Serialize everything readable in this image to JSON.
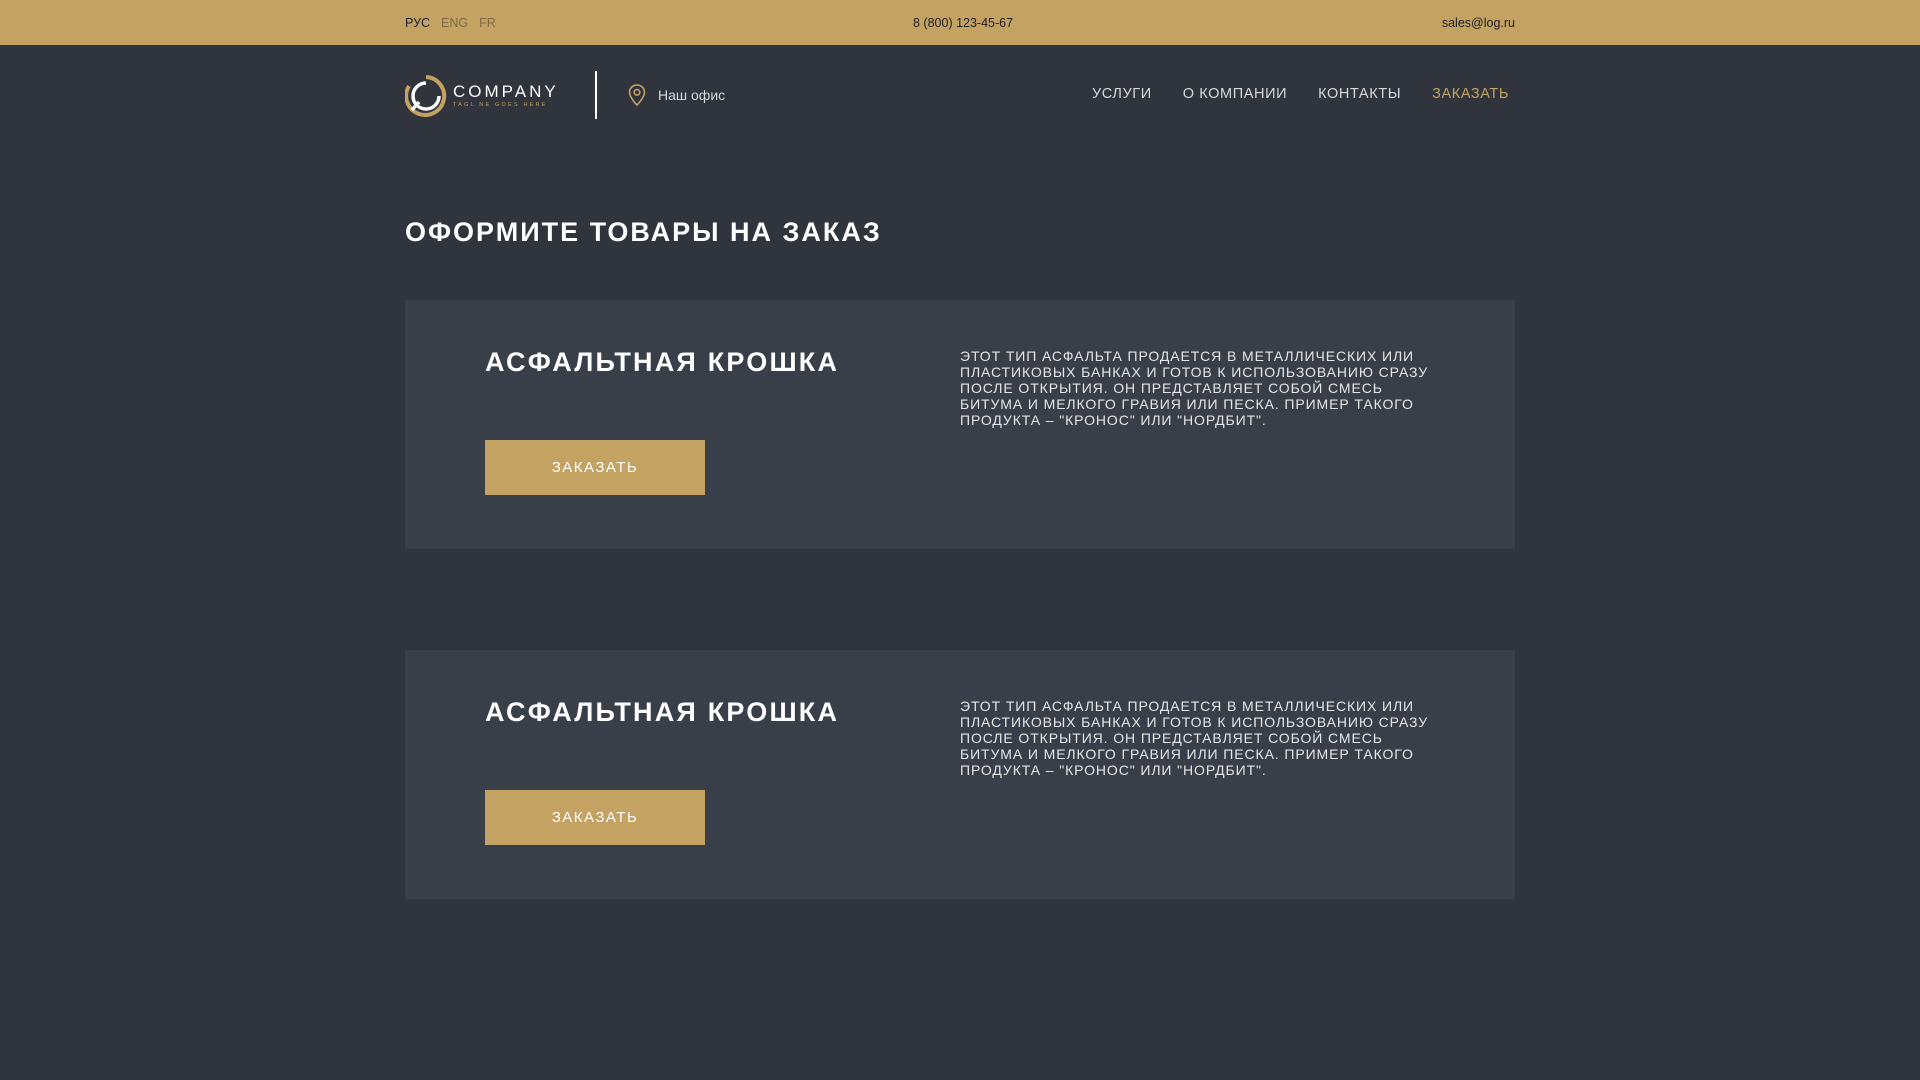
{
  "topbar": {
    "languages": [
      {
        "label": "РУС",
        "active": true
      },
      {
        "label": "ENG",
        "active": false
      },
      {
        "label": "FR",
        "active": false
      }
    ],
    "phone": "8 (800) 123-45-67",
    "email": "sales@log.ru"
  },
  "header": {
    "logo": {
      "title": "COMPANY",
      "tagline": "TAGL NE GOES HERE",
      "icon": "ring-logo-icon"
    },
    "office": {
      "label": "Наш офис",
      "icon": "map-pin-icon"
    },
    "nav": [
      {
        "label": "УСЛУГИ"
      },
      {
        "label": "О КОМПАНИИ"
      },
      {
        "label": "КОНТАКТЫ"
      },
      {
        "label": "ЗАКАЗАТЬ"
      }
    ]
  },
  "main": {
    "title": "ОФОРМИТЕ ТОВАРЫ НА ЗАКАЗ",
    "products": [
      {
        "title": "АСФАЛЬТНАЯ КРОШКА",
        "button": "ЗАКАЗАТЬ",
        "description": "ЭТОТ ТИП АСФАЛЬТА ПРОДАЕТСЯ В МЕТАЛЛИЧЕСКИХ ИЛИ ПЛАСТИКОВЫХ БАНКАХ И ГОТОВ К ИСПОЛЬЗОВАНИЮ СРАЗУ ПОСЛЕ ОТКРЫТИЯ. ОН ПРЕДСТАВЛЯЕТ СОБОЙ СМЕСЬ БИТУМА И МЕЛКОГО ГРАВИЯ ИЛИ ПЕСКА. ПРИМЕР ТАКОГО ПРОДУКТА – \"КРОНОС\" ИЛИ \"НОРДБИТ\"."
      },
      {
        "title": "АСФАЛЬТНАЯ КРОШКА",
        "button": "ЗАКАЗАТЬ",
        "description": "ЭТОТ ТИП АСФАЛЬТА ПРОДАЕТСЯ В МЕТАЛЛИЧЕСКИХ ИЛИ ПЛАСТИКОВЫХ БАНКАХ И ГОТОВ К ИСПОЛЬЗОВАНИЮ СРАЗУ ПОСЛЕ ОТКРЫТИЯ. ОН ПРЕДСТАВЛЯЕТ СОБОЙ СМЕСЬ БИТУМА И МЕЛКОГО ГРАВИЯ ИЛИ ПЕСКА. ПРИМЕР ТАКОГО ПРОДУКТА – \"КРОНОС\" ИЛИ \"НОРДБИТ\"."
      }
    ]
  },
  "colors": {
    "accent": "#c4a262",
    "background": "#2f343d",
    "card": "#393f49"
  }
}
